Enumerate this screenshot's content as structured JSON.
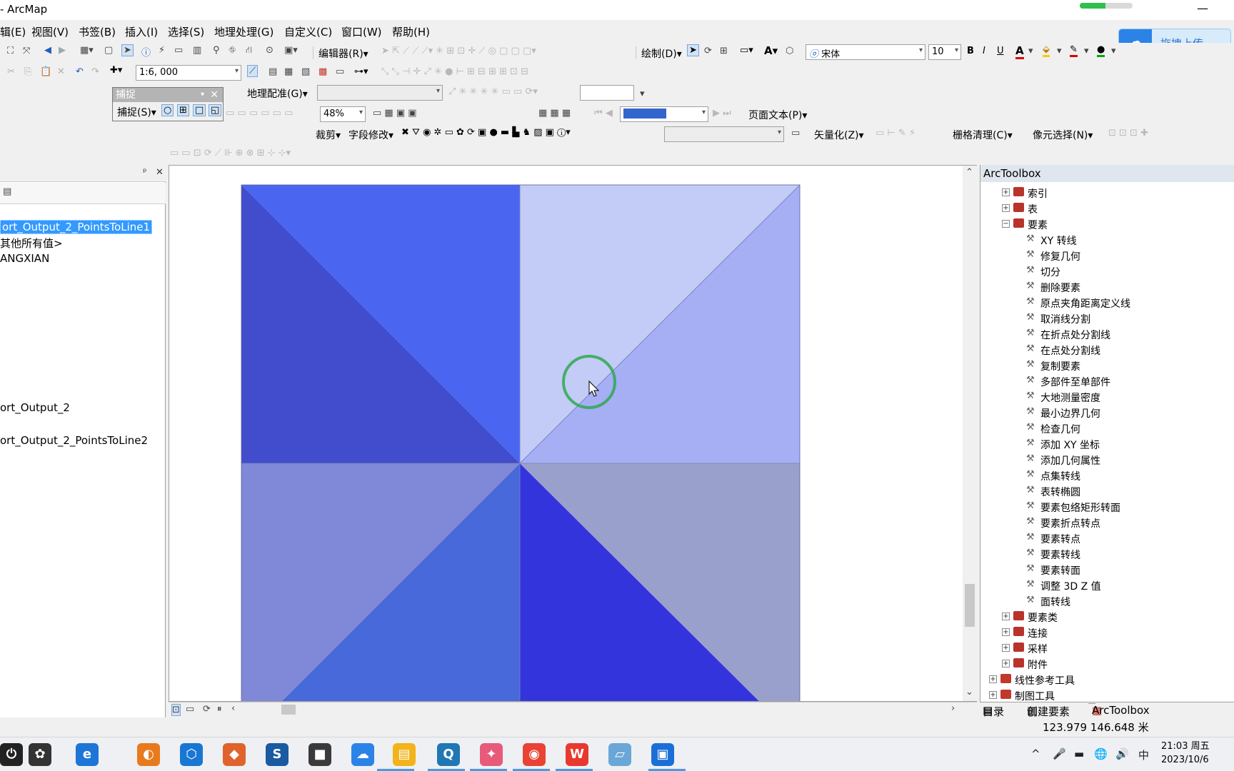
{
  "window": {
    "title": "- ArcMap",
    "minimize_glyph": "—"
  },
  "upload_button": {
    "label": "拖拽上传",
    "icon": "baidu-cloud-icon"
  },
  "green_progress": {
    "value": 0.48
  },
  "menu": [
    "辑(E)",
    "视图(V)",
    "书签(B)",
    "插入(I)",
    "选择(S)",
    "地理处理(G)",
    "自定义(C)",
    "窗口(W)",
    "帮助(H)"
  ],
  "toolbar1": {
    "editor_label": "编辑器(R)▾",
    "draw_label": "绘制(D)▾",
    "font_name": "宋体",
    "font_size": "10",
    "bold": "B",
    "italic": "I",
    "underline": "U",
    "text_color": "A"
  },
  "toolbar2": {
    "scale": "1:6, 000"
  },
  "snapping": {
    "title": "捕捉",
    "close": "✕",
    "dropdown_label": "捕捉(S)▾"
  },
  "toolbar3": {
    "georef_label": "地理配准(G)▾",
    "zoom_pct": "48%",
    "page_text_label": "页面文本(P)▾"
  },
  "toolbar4": {
    "clip_label": "裁剪▾",
    "field_edit_label": "字段修改▾",
    "vectorize_label": "矢量化(Z)▾",
    "raster_cleanup_label": "栅格清理(C)▾",
    "cell_select_label": "像元选择(N)▾"
  },
  "toc": {
    "pin": "ᵖ",
    "close": "✕",
    "items": [
      {
        "label": "ort_Output_2_PointsToLine1",
        "selected": true
      },
      {
        "label": "其他所有值>",
        "selected": false
      },
      {
        "label": "ANGXIAN",
        "selected": false
      },
      {
        "label": "ort_Output_2",
        "selected": false
      },
      {
        "label": "ort_Output_2_PointsToLine2",
        "selected": false
      }
    ]
  },
  "map": {
    "colors": {
      "top_left_lower": "#414dcc",
      "top_left_upper": "#4a66f0",
      "top_right_upper": "#c2ccf6",
      "top_right_lower": "#a6aef4",
      "bottom_left_outer": "#7f89d8",
      "bottom_left_inner": "#4769d9",
      "bottom_right_inner": "#3434dd",
      "bottom_right_outer": "#9aa0cc"
    }
  },
  "toolbox": {
    "title": "ArcToolbox",
    "groups": [
      {
        "label": "索引",
        "expanded": false
      },
      {
        "label": "表",
        "expanded": false
      },
      {
        "label": "要素",
        "expanded": true
      }
    ],
    "tools": [
      "XY 转线",
      "修复几何",
      "切分",
      "删除要素",
      "原点夹角距离定义线",
      "取消线分割",
      "在折点处分割线",
      "在点处分割线",
      "复制要素",
      "多部件至单部件",
      "大地测量密度",
      "最小边界几何",
      "检查几何",
      "添加 XY 坐标",
      "添加几何属性",
      "点集转线",
      "表转椭圆",
      "要素包络矩形转面",
      "要素折点转点",
      "要素转点",
      "要素转线",
      "要素转面",
      "调整 3D Z 值",
      "面转线"
    ],
    "groups_after": [
      "要素类",
      "连接",
      "采样",
      "附件"
    ],
    "top_groups": [
      "线性参考工具",
      "制图工具"
    ],
    "tabs": [
      "目录",
      "创建要素",
      "ArcToolbox"
    ]
  },
  "status": {
    "coordinates": "123.979  146.648 米"
  },
  "taskbar": {
    "tray": {
      "chevron": "^",
      "mic": "🎤",
      "battery": "▬",
      "network": "🌐",
      "volume": "🔊",
      "ime": "中"
    },
    "clock_time": "21:03 周五",
    "clock_date": "2023/10/6",
    "apps": [
      {
        "name": "power-icon",
        "glyph": "⏻",
        "color": "#222222"
      },
      {
        "name": "kaleidoscope-icon",
        "glyph": "✿",
        "color": "#333333"
      },
      {
        "name": "ie-icon",
        "glyph": "e",
        "color": "#1e75d6"
      },
      {
        "name": "blender-icon",
        "glyph": "◐",
        "color": "#e87a1e"
      },
      {
        "name": "hexagon-app-icon",
        "glyph": "⬡",
        "color": "#1976d2"
      },
      {
        "name": "box-app-icon",
        "glyph": "◆",
        "color": "#e0622c"
      },
      {
        "name": "sketchup-icon",
        "glyph": "S",
        "color": "#1a5aa0"
      },
      {
        "name": "cube-app-icon",
        "glyph": "■",
        "color": "#3a3a3a"
      },
      {
        "name": "baidu-netdisk-icon",
        "glyph": "☁",
        "color": "#2b83e8"
      },
      {
        "name": "file-explorer-icon",
        "glyph": "▤",
        "color": "#f2b31b"
      },
      {
        "name": "arcmap-icon",
        "glyph": "Q",
        "color": "#1f77b4"
      },
      {
        "name": "photo-app-icon",
        "glyph": "✦",
        "color": "#e85a7a"
      },
      {
        "name": "chrome-icon",
        "glyph": "◉",
        "color": "#e94336"
      },
      {
        "name": "wps-icon",
        "glyph": "W",
        "color": "#e8392f"
      },
      {
        "name": "layers-app-icon",
        "glyph": "▱",
        "color": "#6aa7d6"
      },
      {
        "name": "capture-app-icon",
        "glyph": "▣",
        "color": "#1a6fd6"
      }
    ]
  }
}
